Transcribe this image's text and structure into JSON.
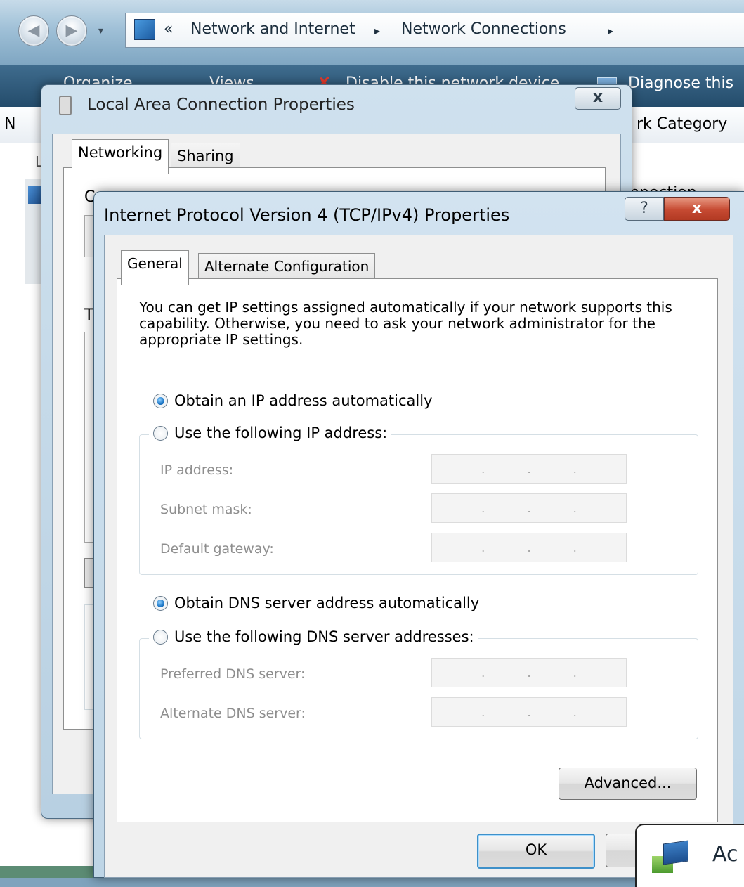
{
  "explorer": {
    "address": {
      "chevron": "«",
      "crumb1": "Network and Internet",
      "sep": "▸",
      "crumb2": "Network Connections",
      "sep2": "▸"
    },
    "toolbar": {
      "organize": "Organize",
      "views": "Views",
      "disable": "Disable this network device",
      "diagnose": "Diagnose this"
    },
    "columns": {
      "left_fragment": "N",
      "category_fragment": "rk Category"
    },
    "side_fragments": {
      "l": "L",
      "connection": "nnection"
    }
  },
  "lac_dialog": {
    "title": "Local Area Connection Properties",
    "close": "x",
    "tabs": [
      "Networking",
      "Sharing"
    ],
    "frag_c": "C",
    "frag_t": "T"
  },
  "ip_dialog": {
    "title": "Internet Protocol Version 4 (TCP/IPv4) Properties",
    "help": "?",
    "close": "x",
    "tabs": [
      "General",
      "Alternate Configuration"
    ],
    "description": "You can get IP settings assigned automatically if your network supports this capability. Otherwise, you need to ask your network administrator for the appropriate IP settings.",
    "radio_auto_ip": "Obtain an IP address automatically",
    "radio_manual_ip": "Use the following IP address:",
    "ip_fields": {
      "ip_label": "IP address:",
      "subnet_label": "Subnet mask:",
      "gateway_label": "Default gateway:"
    },
    "radio_auto_dns": "Obtain DNS server address automatically",
    "radio_manual_dns": "Use the following DNS server addresses:",
    "dns_fields": {
      "preferred_label": "Preferred DNS server:",
      "alternate_label": "Alternate DNS server:"
    },
    "advanced_button": "Advanced...",
    "ok_button": "OK",
    "dot": "."
  },
  "notification": {
    "text_fragment": "Ac"
  }
}
